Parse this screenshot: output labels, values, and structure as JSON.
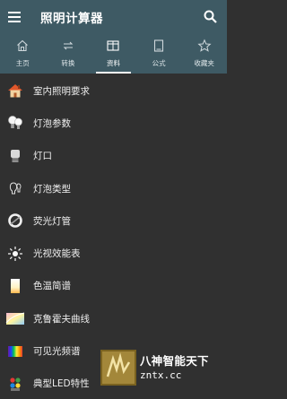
{
  "appbar": {
    "title": "照明计算器",
    "menu_icon": "hamburger-menu-icon",
    "search_icon": "search-icon"
  },
  "tabs": [
    {
      "label": "主页",
      "icon": "home-icon",
      "active": false
    },
    {
      "label": "转换",
      "icon": "swap-icon",
      "active": false
    },
    {
      "label": "资料",
      "icon": "book-icon",
      "active": true
    },
    {
      "label": "公式",
      "icon": "formula-icon",
      "active": false
    },
    {
      "label": "收藏夹",
      "icon": "star-icon",
      "active": false
    }
  ],
  "list": [
    {
      "label": "室内照明要求",
      "icon": "house-icon"
    },
    {
      "label": "灯泡参数",
      "icon": "bulbs-icon"
    },
    {
      "label": "灯口",
      "icon": "lamp-socket-icon"
    },
    {
      "label": "灯泡类型",
      "icon": "bulb-types-icon"
    },
    {
      "label": "荧光灯管",
      "icon": "fluorescent-ring-icon"
    },
    {
      "label": "光视效能表",
      "icon": "sun-rays-icon"
    },
    {
      "label": "色温简谱",
      "icon": "color-temperature-icon"
    },
    {
      "label": "克鲁霍夫曲线",
      "icon": "kruithof-curve-icon"
    },
    {
      "label": "可见光频谱",
      "icon": "spectrum-icon"
    },
    {
      "label": "典型LED特性",
      "icon": "led-icon"
    }
  ],
  "watermark": {
    "line1": "八神智能天下",
    "line2": "zntx.cc"
  },
  "colors": {
    "appbar": "#3e5a64",
    "background": "#303030",
    "text": "#eeeeee"
  }
}
